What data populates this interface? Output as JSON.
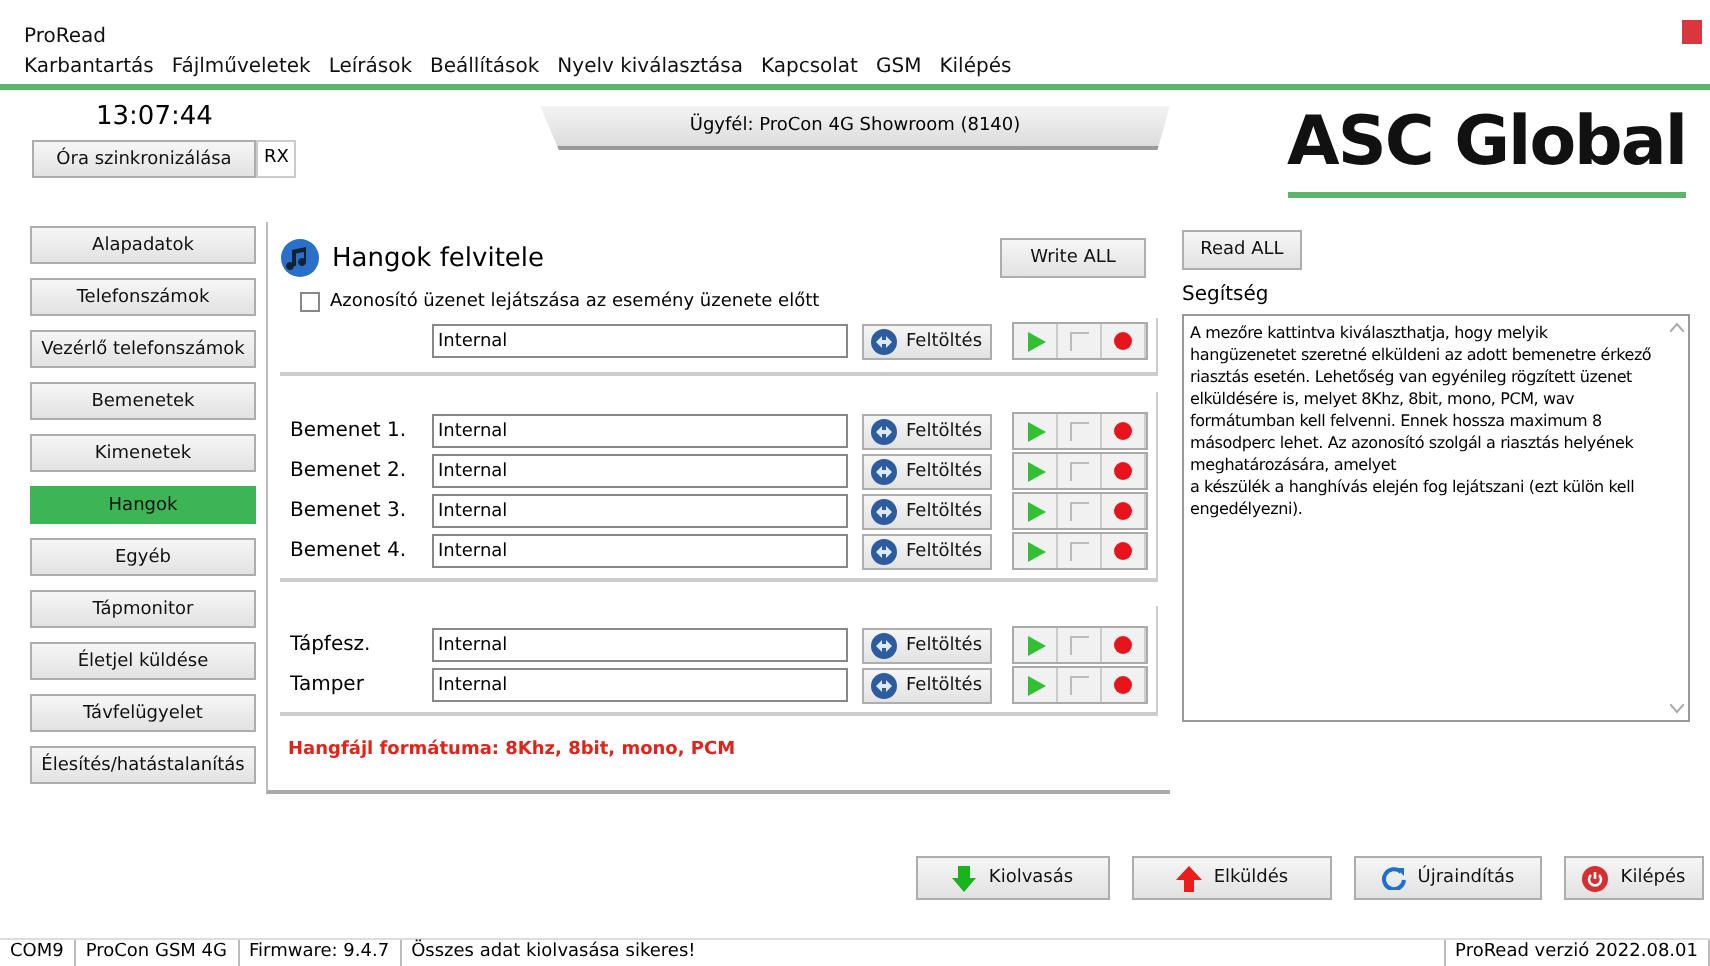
{
  "window": {
    "title": "ProRead"
  },
  "menu": [
    "Karbantartás",
    "Fájlműveletek",
    "Leírások",
    "Beállítások",
    "Nyelv kiválasztása",
    "Kapcsolat",
    "GSM",
    "Kilépés"
  ],
  "clock": "13:07:44",
  "sync_button": "Óra szinkronizálása",
  "rx_label": "RX",
  "customer_tab": "Ügyfél: ProCon 4G Showroom (8140)",
  "logo": "ASC Global",
  "sidebar": [
    {
      "label": "Alapadatok",
      "selected": false
    },
    {
      "label": "Telefonszámok",
      "selected": false
    },
    {
      "label": "Vezérlő telefonszámok",
      "selected": false
    },
    {
      "label": "Bemenetek",
      "selected": false
    },
    {
      "label": "Kimenetek",
      "selected": false
    },
    {
      "label": "Hangok",
      "selected": true
    },
    {
      "label": "Egyéb",
      "selected": false
    },
    {
      "label": "Tápmonitor",
      "selected": false
    },
    {
      "label": "Életjel küldése",
      "selected": false
    },
    {
      "label": "Távfelügyelet",
      "selected": false
    },
    {
      "label": "Élesítés/hatástalanítás",
      "selected": false
    }
  ],
  "panel": {
    "title": "Hangok felvitele",
    "write_all": "Write ALL",
    "id_checkbox": {
      "label": "Azonosító üzenet lejátszása az esemény üzenete előtt",
      "checked": false
    },
    "sections": [
      {
        "rows": [
          {
            "value": "Internal",
            "upload": "Feltöltés"
          }
        ]
      },
      {
        "rows": [
          {
            "label": "Bemenet 1.",
            "value": "Internal",
            "upload": "Feltöltés"
          },
          {
            "label": "Bemenet 2.",
            "value": "Internal",
            "upload": "Feltöltés"
          },
          {
            "label": "Bemenet 3.",
            "value": "Internal",
            "upload": "Feltöltés"
          },
          {
            "label": "Bemenet 4.",
            "value": "Internal",
            "upload": "Feltöltés"
          }
        ]
      },
      {
        "rows": [
          {
            "label": "Tápfesz.",
            "value": "Internal",
            "upload": "Feltöltés"
          },
          {
            "label": "Tamper",
            "value": "Internal",
            "upload": "Feltöltés"
          }
        ]
      }
    ],
    "format_note": "Hangfájl formátuma: 8Khz, 8bit, mono, PCM"
  },
  "help": {
    "read_all": "Read ALL",
    "title": "Segítség",
    "text": "A mezőre kattintva kiválaszthatja, hogy melyik hangüzenetet szeretné elküldeni az adott bemenetre érkező riasztás esetén. Lehetőség van egyénileg rögzített üzenet elküldésére is, melyet 8Khz, 8bit, mono, PCM, wav formátumban kell felvenni. Ennek hossza maximum 8 másodperc lehet.  Az azonosító szolgál a riasztás helyének meghatározására, amelyet\na készülék a hanghívás elején fog lejátszani (ezt külön kell engedélyezni)."
  },
  "actions": [
    {
      "kind": "download",
      "label": "Kiolvasás"
    },
    {
      "kind": "upload",
      "label": "Elküldés"
    },
    {
      "kind": "restart",
      "label": "Újraindítás"
    },
    {
      "kind": "exit",
      "label": "Kilépés"
    }
  ],
  "status_bar": [
    "COM9",
    "ProCon GSM 4G",
    "Firmware: 9.4.7",
    "Összes adat kiolvasása sikeres!",
    "ProRead verzió 2022.08.01"
  ]
}
